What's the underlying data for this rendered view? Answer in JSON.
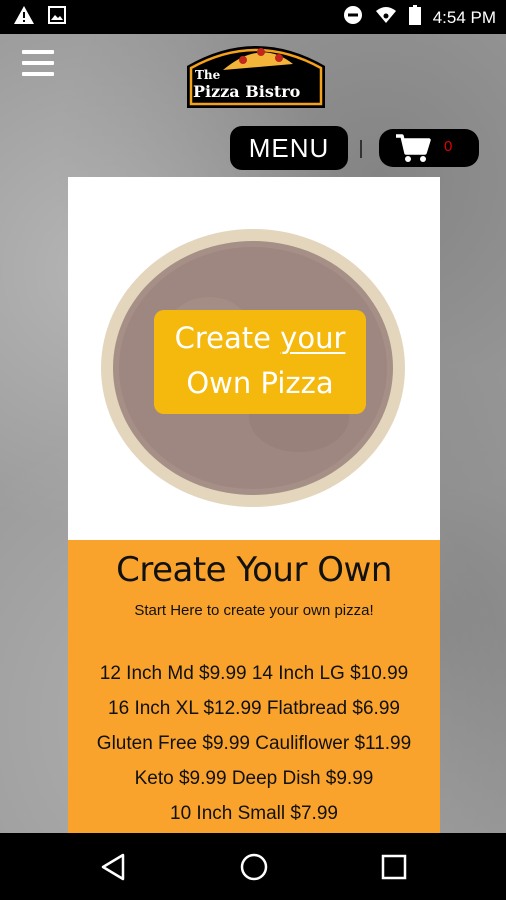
{
  "status_bar": {
    "time": "4:54 PM",
    "icons": [
      "warning-icon",
      "image-icon",
      "do-not-disturb-icon",
      "wifi-icon",
      "battery-icon"
    ]
  },
  "header": {
    "logo_line1": "The",
    "logo_line2": "Pizza Bistro",
    "menu_label": "MENU",
    "cart_count": "0"
  },
  "product": {
    "badge_line1_a": "Create ",
    "badge_line1_b": "your",
    "badge_line2": "Own Pizza",
    "title": "Create Your Own",
    "subtitle": "Start Here to create your own pizza!",
    "prices": [
      "12 Inch Md $9.99  14 Inch LG $10.99",
      "16 Inch XL $12.99  Flatbread $6.99",
      "Gluten Free $9.99  Cauliflower $11.99",
      "Keto $9.99  Deep Dish $9.99",
      "10 Inch Small $7.99"
    ]
  },
  "colors": {
    "accent_orange": "#f9a32c",
    "badge_yellow": "#f5b90e",
    "cart_count_red": "#e30000"
  }
}
